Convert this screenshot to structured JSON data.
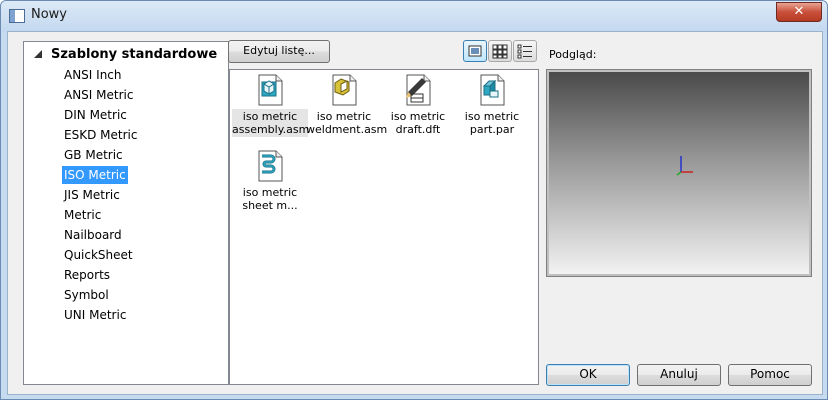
{
  "window": {
    "title": "Nowy",
    "close_symbol": "✕"
  },
  "tree": {
    "root": "Szablony standardowe",
    "items": [
      {
        "label": "ANSI Inch"
      },
      {
        "label": "ANSI Metric"
      },
      {
        "label": "DIN Metric"
      },
      {
        "label": "ESKD Metric"
      },
      {
        "label": "GB Metric"
      },
      {
        "label": "ISO Metric",
        "selected": true
      },
      {
        "label": "JIS Metric"
      },
      {
        "label": "Metric"
      },
      {
        "label": "Nailboard"
      },
      {
        "label": "QuickSheet"
      },
      {
        "label": "Reports"
      },
      {
        "label": "Symbol"
      },
      {
        "label": "UNI Metric"
      }
    ]
  },
  "toolbar": {
    "edit_list_label": "Edytuj listę...",
    "views": [
      "large-icons-view",
      "small-icons-view",
      "list-view"
    ]
  },
  "files": [
    {
      "line1": "iso metric",
      "line2": "assembly.asm",
      "icon": "assembly-file-icon",
      "selected": true
    },
    {
      "line1": "iso metric",
      "line2": "weldment.asm",
      "icon": "weldment-file-icon"
    },
    {
      "line1": "iso metric",
      "line2": "draft.dft",
      "icon": "draft-file-icon"
    },
    {
      "line1": "iso metric",
      "line2": "part.par",
      "icon": "part-file-icon"
    },
    {
      "line1": "iso metric",
      "line2": "sheet m...",
      "icon": "sheet-metal-file-icon"
    }
  ],
  "preview": {
    "label": "Podgląd:"
  },
  "buttons": {
    "ok": "OK",
    "cancel": "Anuluj",
    "help": "Pomoc"
  }
}
